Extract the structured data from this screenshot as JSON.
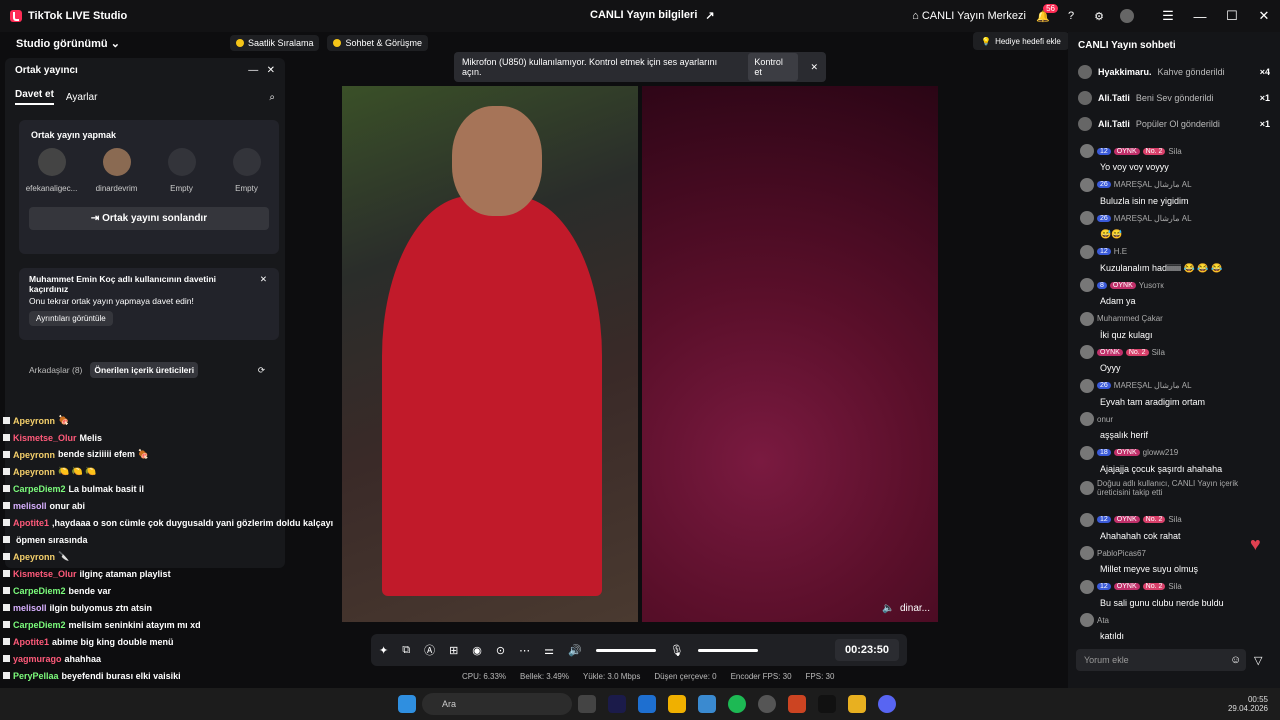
{
  "titlebar": {
    "app": "TikTok LIVE Studio",
    "center": "CANLI Yayın bilgileri",
    "center_link": "CANLI Yayın Merkezi",
    "badge": "56"
  },
  "topbar": {
    "studio": "Studio görünümü",
    "tab1": "Saatlik Sıralama",
    "tab2": "Sohbet & Görüşme",
    "gift_goal": "Hediye hedefi ekle"
  },
  "toast": {
    "text": "Mikrofon (U850) kullanılamıyor. Kontrol etmek için ses ayarlarını açın.",
    "button": "Kontrol et"
  },
  "panel": {
    "title": "Ortak yayıncı",
    "tabs": [
      "Davet et",
      "Ayarlar"
    ],
    "section": "Ortak yayın yapmak",
    "avatars": [
      "efekanaligec...",
      "dinardevrim",
      "Empty",
      "Empty"
    ],
    "end": "Ortak yayını sonlandır",
    "missed_title": "Muhammet Emin Koç adlı kullanıcının davetini kaçırdınız",
    "missed_sub": "Onu tekrar ortak yayın yapmaya davet edin!",
    "details": "Ayrıntıları görüntüle",
    "friends": "Arkadaşlar (8)",
    "suggested": "Önerilen içerik üreticileri"
  },
  "left_chat": [
    {
      "n": "Apeyronn",
      "t": "🍖",
      "c": "yellow"
    },
    {
      "n": "Kismetse_Olur",
      "t": "Melis",
      "c": "pink"
    },
    {
      "n": "Apeyronn",
      "t": "bende siziiiii efem 🍖",
      "c": "yellow"
    },
    {
      "n": "Apeyronn",
      "t": "🍋 🍋 🍋",
      "c": "yellow"
    },
    {
      "n": "CarpeDiem2",
      "t": "La bulmak basit il",
      "c": "green"
    },
    {
      "n": "melisoll",
      "t": "onur abi",
      "c": "purple"
    },
    {
      "n": "Apotite1",
      "t": ",haydaaa o son cümle çok duygusaldı yani gözlerim doldu kalçayı",
      "c": "pink"
    },
    {
      "n": "",
      "t": "öpmen sırasında",
      "c": "yellow"
    },
    {
      "n": "Apeyronn",
      "t": "🔪",
      "c": "yellow"
    },
    {
      "n": "Kismetse_Olur",
      "t": "ilginç ataman playlist",
      "c": "pink"
    },
    {
      "n": "CarpeDiem2",
      "t": "bende var",
      "c": "green"
    },
    {
      "n": "melisoll",
      "t": "ilgin bulyomus ztn atsin",
      "c": "purple"
    },
    {
      "n": "CarpeDiem2",
      "t": "melisim seninkini atayım mı xd",
      "c": "green"
    },
    {
      "n": "Apotite1",
      "t": "abime big king double menü",
      "c": "pink"
    },
    {
      "n": "yagmurago",
      "t": "ahahhaa",
      "c": "pink"
    },
    {
      "n": "PeryPellaa",
      "t": "beyefendi burası elki vaisiki",
      "c": "green"
    }
  ],
  "video": {
    "name": "dinar..."
  },
  "controls": {
    "time": "00:23:50"
  },
  "stats": [
    "CPU: 6.33%",
    "Bellek: 3.49%",
    "Yükle: 3.0 Mbps",
    "Düşen çerçeve: 0",
    "Encoder FPS: 30",
    "FPS: 30"
  ],
  "right": {
    "title": "CANLI Yayın sohbeti",
    "pinned": [
      {
        "n": "Hyakkimaru.",
        "t": "Kahve gönderildi",
        "x": "×4"
      },
      {
        "n": "Ali.Tatli",
        "t": "Beni Sev gönderildi",
        "x": "×1"
      },
      {
        "n": "Ali.Tatli",
        "t": "Popüler Ol gönderildi",
        "x": "×1"
      }
    ],
    "messages": [
      {
        "u": "Sila",
        "tags": [
          "12",
          "OYNK",
          "No. 2"
        ],
        "t": "Yo voy voy voyyy"
      },
      {
        "u": "MAREŞAL مارشال AL",
        "tags": [
          "26"
        ],
        "t": "Buluzla isin ne yigidim"
      },
      {
        "u": "MAREŞAL مارشال AL",
        "tags": [
          "26"
        ],
        "t": "😅😅"
      },
      {
        "u": "H.E",
        "tags": [
          "12"
        ],
        "t": "Kuzulanalım hadiiiiiii 😂 😂 😂"
      },
      {
        "u": "Yusoтк",
        "tags": [
          "8",
          "OYNK"
        ],
        "t": "Adam ya"
      },
      {
        "u": "Muhammed Çakar",
        "tags": [],
        "t": "İki quz kulagı"
      },
      {
        "u": "Sila",
        "tags": [
          "OYNK",
          "No. 2"
        ],
        "t": "Oyyy"
      },
      {
        "u": "MAREŞAL مارشال AL",
        "tags": [
          "26"
        ],
        "t": "Eyvah tam aradigim ortam"
      },
      {
        "u": "onur",
        "tags": [],
        "t": "aşşalık herif"
      },
      {
        "u": "gloww219",
        "tags": [
          "18",
          "OYNK"
        ],
        "t": "Ajajajja çocuk şaşırdı ahahaha"
      },
      {
        "u": "Doğuu adlı kullanıcı, CANLI Yayın içerik üreticisini takip etti",
        "tags": [],
        "t": ""
      },
      {
        "u": "Sila",
        "tags": [
          "12",
          "OYNK",
          "No. 2"
        ],
        "t": "Ahahahah cok rahat"
      },
      {
        "u": "PabloPicas67",
        "tags": [],
        "t": "Millet meyve suyu olmuş"
      },
      {
        "u": "Sila",
        "tags": [
          "12",
          "OYNK",
          "No. 2"
        ],
        "t": "Bu sali gunu clubu nerde buldu"
      },
      {
        "u": "Ata",
        "tags": [],
        "t": "katıldı"
      }
    ],
    "input": "Yorum ekle"
  },
  "taskbar": {
    "search": "Ara",
    "time": "00:55",
    "date": "29.04.2026"
  }
}
